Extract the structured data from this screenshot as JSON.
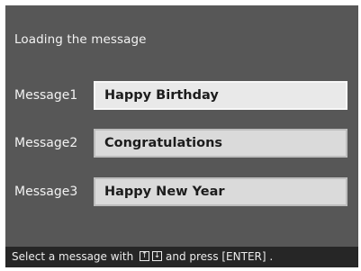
{
  "screen": {
    "title": "Loading the message",
    "messages": [
      {
        "label": "Message1",
        "value": "Happy Birthday",
        "selected": true
      },
      {
        "label": "Message2",
        "value": "Congratulations",
        "selected": false
      },
      {
        "label": "Message3",
        "value": "Happy New Year",
        "selected": false
      }
    ]
  },
  "status_bar": {
    "text_before": "Select a message with",
    "up_key_glyph": "↑",
    "down_key_glyph": "↓",
    "text_after": "and press [ENTER] ."
  },
  "colors": {
    "background": "#575757",
    "status_bar": "#262626",
    "field": "#dadada",
    "field_selected_border": "#f7f7f7"
  },
  "icons": [
    "up-arrow-key-icon",
    "down-arrow-key-icon"
  ]
}
